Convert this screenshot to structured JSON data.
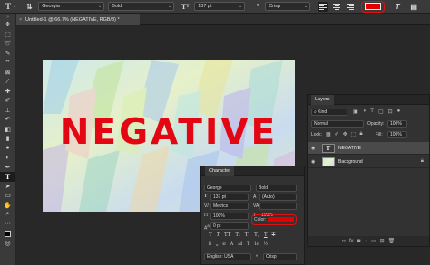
{
  "options_bar": {
    "font_family": "Georgia",
    "font_style": "Bold",
    "font_size": "137 pt",
    "anti_alias": "Crisp",
    "text_color": "#e00000"
  },
  "document_tab": {
    "close": "×",
    "title": "Untitled-1 @ 66.7% (NEGATIVE, RGB/8) *"
  },
  "canvas": {
    "headline": "NEGATIVE",
    "text_color": "#e30613"
  },
  "layers_panel": {
    "title": "Layers",
    "kind": "Kind",
    "blend_mode": "Normal",
    "opacity_label": "Opacity:",
    "opacity": "100%",
    "lock_label": "Lock:",
    "fill_label": "Fill:",
    "fill": "100%",
    "layers": [
      {
        "name": "NEGATIVE",
        "type": "text",
        "selected": true
      },
      {
        "name": "Background",
        "type": "image",
        "selected": false
      }
    ]
  },
  "character_panel": {
    "title": "Character",
    "font_family": "George",
    "font_style": "Bold",
    "font_size": "137 pt",
    "leading": "(Auto)",
    "tracking_left": "100%",
    "kerning": "Metrics",
    "baseline": "0 pt",
    "vertical_scale": "100%",
    "color_label": "Color:",
    "color": "#e30000",
    "language": "English: USA",
    "anti_alias": "Crisp",
    "faux_styles": [
      "T",
      "T",
      "TT",
      "Tt",
      "T¹",
      "T₁",
      "T",
      "T"
    ],
    "ot_features": [
      "fi",
      "ℴ",
      "st",
      "A",
      "ad",
      "T",
      "1st",
      "½"
    ]
  }
}
